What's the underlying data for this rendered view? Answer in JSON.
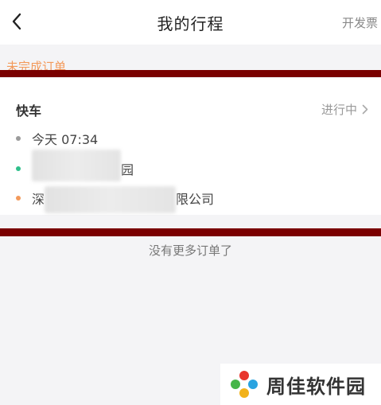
{
  "header": {
    "title": "我的行程",
    "invoice_label": "开发票",
    "back_icon": "chevron-left-icon"
  },
  "section": {
    "label": "未完成订单"
  },
  "order": {
    "ride_type": "快车",
    "status": "进行中",
    "status_icon": "chevron-right-icon",
    "time": "今天 07:34",
    "start_suffix": "园",
    "end_prefix": "深",
    "end_suffix": "限公司",
    "colors": {
      "time_dot": "#9b9b9b",
      "start_dot": "#2fbf8b",
      "end_dot": "#f39a5b"
    }
  },
  "footer": {
    "no_more": "没有更多订单了"
  },
  "watermark": {
    "text": "周佳软件园"
  }
}
